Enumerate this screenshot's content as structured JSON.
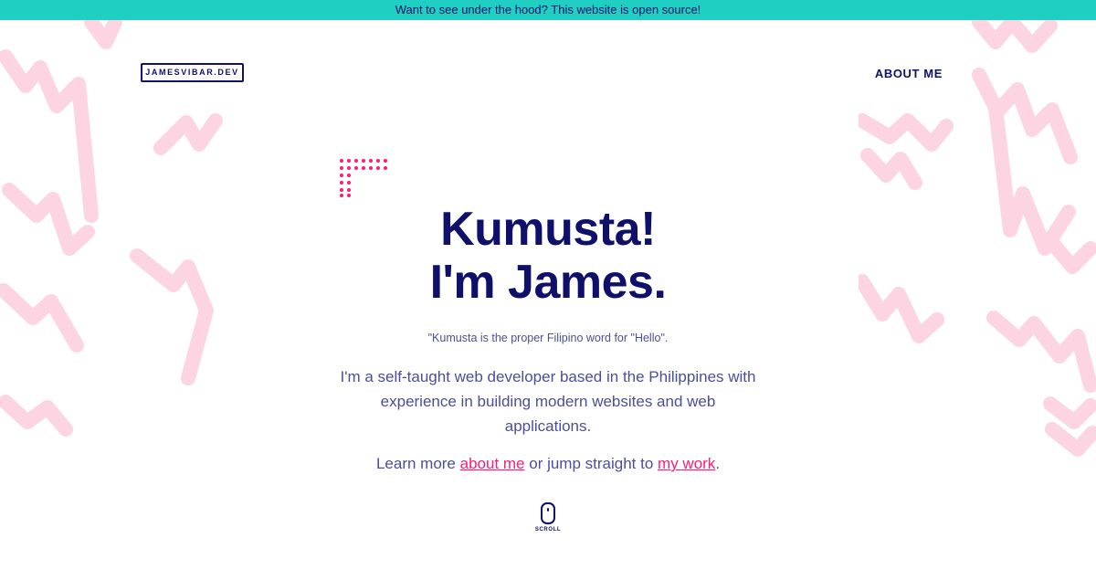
{
  "banner": {
    "text": "Want to see under the hood? This website is open source!"
  },
  "header": {
    "logo": "JAMESVIBAR.DEV",
    "nav_about": "ABOUT ME"
  },
  "hero": {
    "title_line1": "Kumusta!",
    "title_line2": "I'm James.",
    "note": "\"Kumusta is the proper Filipino word for \"Hello\".",
    "description": "I'm a self-taught web developer based in the Philippines with experience in building modern websites and web applications.",
    "cta_prefix": "Learn more ",
    "cta_about_link": "about me",
    "cta_middle": " or jump straight to ",
    "cta_work_link": "my work",
    "cta_suffix": "."
  },
  "scroll": {
    "label": "SCROLL"
  },
  "colors": {
    "banner_bg": "#1fcfc4",
    "navy": "#0e1069",
    "body_text": "#4a4f98",
    "accent_pink": "#ff1a7a",
    "squiggle_pink": "#fdd5e2"
  },
  "icons": {
    "dots": "dot-grid-decoration",
    "scroll": "mouse-scroll-icon"
  }
}
